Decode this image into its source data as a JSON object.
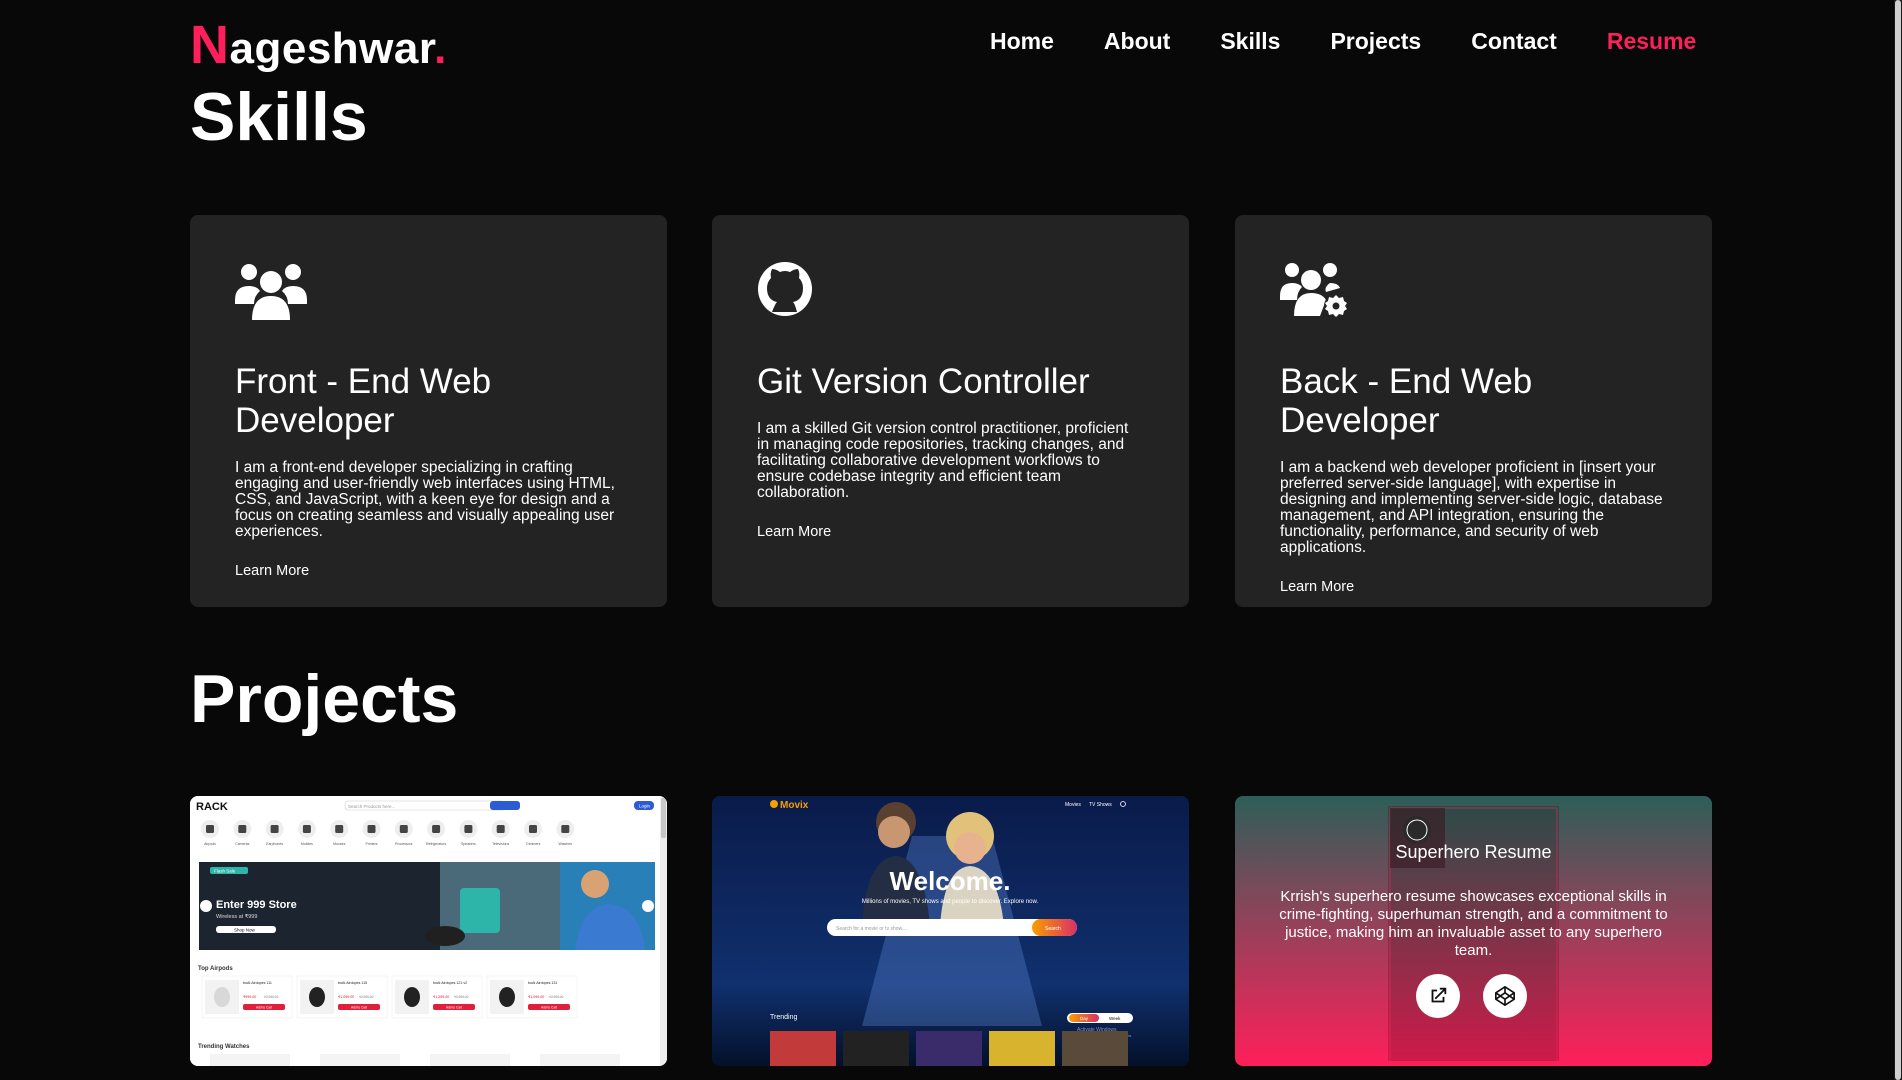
{
  "brand": {
    "first": "N",
    "rest": "ageshwar",
    "dot": "."
  },
  "nav": {
    "home": "Home",
    "about": "About",
    "skills": "Skills",
    "projects": "Projects",
    "contact": "Contact",
    "resume": "Resume"
  },
  "skills": {
    "title": "Skills",
    "cards": [
      {
        "icon": "users-icon",
        "title": "Front - End Web Developer",
        "desc": "I am a front-end developer specializing in crafting engaging and user-friendly web interfaces using HTML, CSS, and JavaScript, with a keen eye for design and a focus on creating seamless and visually appealing user experiences.",
        "link": "Learn More"
      },
      {
        "icon": "github-icon",
        "title": "Git Version Controller",
        "desc": "I am a skilled Git version control practitioner, proficient in managing code repositories, tracking changes, and facilitating collaborative development workflows to ensure codebase integrity and efficient team collaboration.",
        "link": "Learn More"
      },
      {
        "icon": "users-gear-icon",
        "title": "Back - End Web Developer",
        "desc": "I am a backend web developer proficient in [insert your preferred server-side language], with expertise in designing and implementing server-side logic, database management, and API integration, ensuring the functionality, performance, and security of web applications.",
        "link": "Learn More"
      }
    ]
  },
  "projects": {
    "title": "Projects",
    "rack": {
      "logo": "RACK",
      "search_placeholder": "Search Products here...",
      "login": "Login",
      "categories": [
        "Airpods",
        "Cameras",
        "Earphones",
        "Mobiles",
        "Mouses",
        "Printers",
        "Processors",
        "Refrigerators",
        "Speakers",
        "Televisions",
        "Trimmers",
        "Watches"
      ],
      "banner_small": "Flash Sale",
      "banner_title": "Enter 999 Store",
      "banner_sub": "Wireless at ₹999",
      "banner_btn": "Shop Now",
      "top_airpods": "Top Airpods",
      "trending_watches": "Trending Watches",
      "products": [
        {
          "name": "boAt Airdopes 111",
          "price": "₹999.00",
          "old": "₹2,990.00",
          "btn": "Add to Cart"
        },
        {
          "name": "boAt Airdopes 115",
          "price": "₹1,099.00",
          "old": "₹2,990.00",
          "btn": "Add to Cart"
        },
        {
          "name": "boAt Airdopes 121 v2",
          "price": "₹1,299.00",
          "old": "₹2,990.00",
          "btn": "Add to Cart"
        },
        {
          "name": "boAt Airdopes 131",
          "price": "₹1,099.00",
          "old": "₹2,990.00",
          "btn": "Add to Cart"
        }
      ]
    },
    "movix": {
      "logo": "Movix",
      "nav": [
        "Movies",
        "TV Shows"
      ],
      "welcome": "Welcome.",
      "tagline": "Millions of movies, TV shows and people to discover. Explore now.",
      "search_placeholder": "Search for a movie or tv show....",
      "search_btn": "Search",
      "trending": "Trending",
      "toggle": [
        "Day",
        "Week"
      ],
      "activate_title": "Activate Windows",
      "activate_sub": "Go to Settings to activate Windows."
    },
    "superhero": {
      "title": "Superhero Resume",
      "desc": "Krrish's superhero resume showcases exceptional skills in crime-fighting, superhuman strength, and a commitment to justice, making him an invaluable asset to any superhero team."
    }
  }
}
